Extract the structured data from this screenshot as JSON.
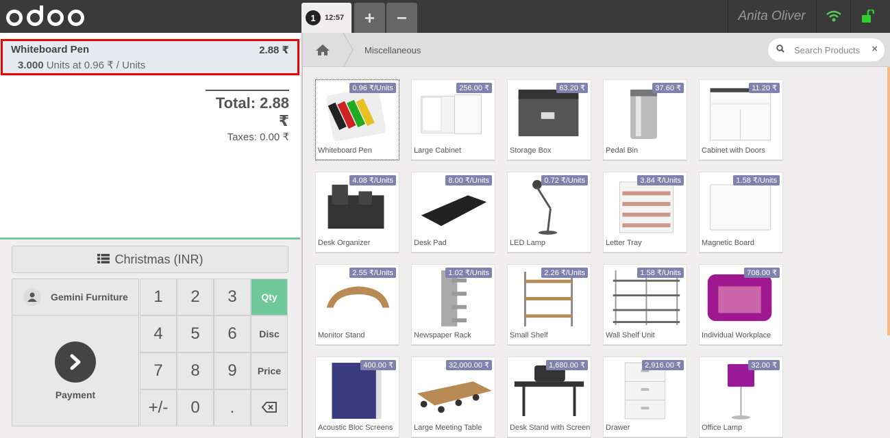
{
  "header": {
    "logo_text": "odoo",
    "order": {
      "number": "1",
      "time": "12:57"
    },
    "add_order_label": "+",
    "remove_order_label": "−",
    "cashier": "Anita Oliver"
  },
  "orderline": {
    "name": "Whiteboard Pen",
    "price": "2.88 ₹",
    "quantity": "3.000",
    "info": " Units at 0.96 ₹ / Units"
  },
  "summary": {
    "total": "Total: 2.88 ₹",
    "taxes": "Taxes: 0.00 ₹"
  },
  "controls": {
    "pricelist": "Christmas (INR)",
    "customer": "Gemini Furniture",
    "payment": "Payment"
  },
  "numpad": {
    "k1": "1",
    "k2": "2",
    "k3": "3",
    "qty": "Qty",
    "k4": "4",
    "k5": "5",
    "k6": "6",
    "disc": "Disc",
    "k7": "7",
    "k8": "8",
    "k9": "9",
    "price": "Price",
    "sign": "+/-",
    "k0": "0",
    "dot": ".",
    "active_mode": "Qty"
  },
  "breadcrumb": {
    "category": "Miscellaneous"
  },
  "search": {
    "placeholder": "Search Products",
    "clear": "×"
  },
  "colors": {
    "accent": "#6ec89b",
    "price_tag": "#7f82ac",
    "highlight": "#e00000",
    "header": "#3a3a3a"
  },
  "products": [
    {
      "name": "Whiteboard Pen",
      "price": "0.96 ₹/Units",
      "icon": "whiteboard-pen"
    },
    {
      "name": "Large Cabinet",
      "price": "256.00 ₹",
      "icon": "cabinet"
    },
    {
      "name": "Storage Box",
      "price": "63.20 ₹",
      "icon": "storage-box"
    },
    {
      "name": "Pedal Bin",
      "price": "37.60 ₹",
      "icon": "bin"
    },
    {
      "name": "Cabinet with Doors",
      "price": "11.20 ₹",
      "icon": "cabinet-doors"
    },
    {
      "name": "Desk Organizer",
      "price": "4.08 ₹/Units",
      "icon": "organizer"
    },
    {
      "name": "Desk Pad",
      "price": "8.00 ₹/Units",
      "icon": "desk-pad"
    },
    {
      "name": "LED Lamp",
      "price": "0.72 ₹/Units",
      "icon": "lamp"
    },
    {
      "name": "Letter Tray",
      "price": "3.84 ₹/Units",
      "icon": "tray"
    },
    {
      "name": "Magnetic Board",
      "price": "1.58 ₹/Units",
      "icon": "board"
    },
    {
      "name": "Monitor Stand",
      "price": "2.55 ₹/Units",
      "icon": "monitor-stand"
    },
    {
      "name": "Newspaper Rack",
      "price": "1.02 ₹/Units",
      "icon": "rack"
    },
    {
      "name": "Small Shelf",
      "price": "2.26 ₹/Units",
      "icon": "shelf"
    },
    {
      "name": "Wall Shelf Unit",
      "price": "1.58 ₹/Units",
      "icon": "wall-shelf"
    },
    {
      "name": "Individual Workplace",
      "price": "708.00 ₹",
      "icon": "workplace"
    },
    {
      "name": "Acoustic Bloc Screens",
      "price": "400.00 ₹",
      "icon": "screen"
    },
    {
      "name": "Large Meeting Table",
      "price": "32,000.00 ₹",
      "icon": "meeting-table"
    },
    {
      "name": "Desk Stand with Screen",
      "price": "1,680.00 ₹",
      "icon": "desk-stand"
    },
    {
      "name": "Drawer",
      "price": "2,916.00 ₹",
      "icon": "drawer"
    },
    {
      "name": "Office Lamp",
      "price": "32.00 ₹",
      "icon": "office-lamp"
    }
  ]
}
